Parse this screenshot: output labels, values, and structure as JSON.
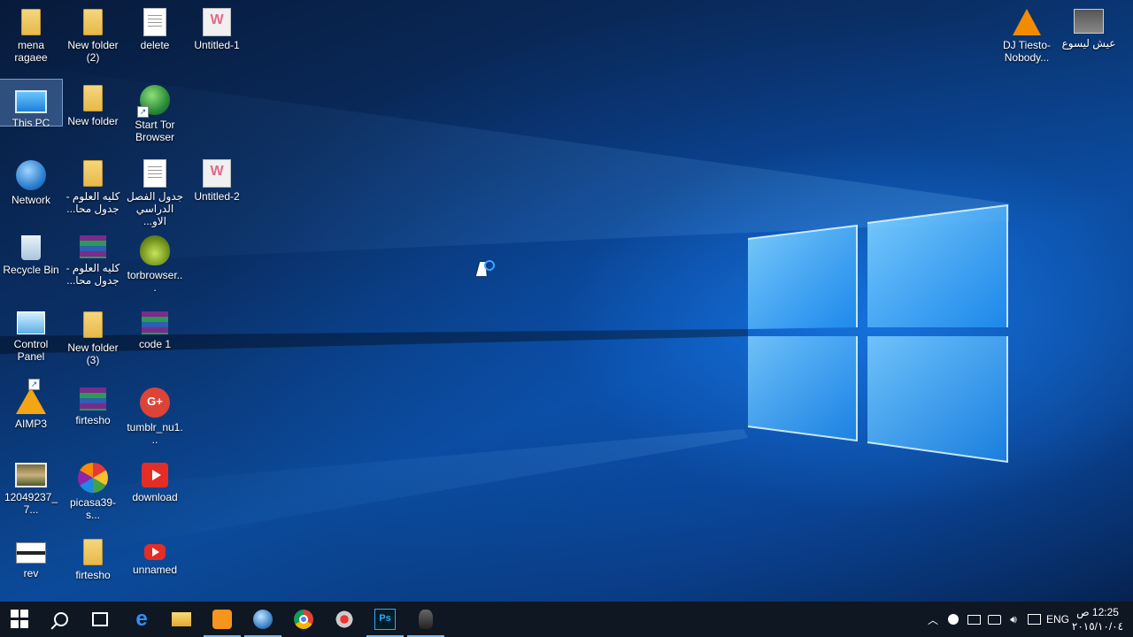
{
  "desktop": {
    "icons": [
      {
        "label": "mena ragaee"
      },
      {
        "label": "New folder (2)"
      },
      {
        "label": "delete"
      },
      {
        "label": "Untitled-1"
      },
      {
        "label": "This PC"
      },
      {
        "label": "New folder"
      },
      {
        "label": "Start Tor Browser"
      },
      {
        "label": "Network"
      },
      {
        "label": "كليه العلوم - جدول محا..."
      },
      {
        "label": "جدول الفصل الدراسي الاو..."
      },
      {
        "label": "Untitled-2"
      },
      {
        "label": "Recycle Bin"
      },
      {
        "label": "كليه العلوم - جدول محا..."
      },
      {
        "label": "torbrowser..."
      },
      {
        "label": "Control Panel"
      },
      {
        "label": "New folder (3)"
      },
      {
        "label": "code 1"
      },
      {
        "label": "AIMP3"
      },
      {
        "label": "firtesho"
      },
      {
        "label": "tumblr_nu1..."
      },
      {
        "label": "12049237_7..."
      },
      {
        "label": "picasa39-s..."
      },
      {
        "label": "download"
      },
      {
        "label": "rev"
      },
      {
        "label": "firtesho"
      },
      {
        "label": "unnamed"
      },
      {
        "label": "DJ Tiesto- Nobody..."
      },
      {
        "label": "عيش ليسوع"
      }
    ],
    "selected_icon": "This PC"
  },
  "taskbar": {
    "apps": [
      {
        "name": "start-button",
        "icon": "windows-logo-icon"
      },
      {
        "name": "search",
        "icon": "search-icon"
      },
      {
        "name": "task-view",
        "icon": "task-view-icon"
      },
      {
        "name": "edge",
        "icon": "edge-icon"
      },
      {
        "name": "file-explorer",
        "icon": "folder-icon"
      },
      {
        "name": "orange-app",
        "icon": "orange-app-icon"
      },
      {
        "name": "sphere-app",
        "icon": "sphere-icon"
      },
      {
        "name": "chrome",
        "icon": "chrome-icon"
      },
      {
        "name": "tool-app",
        "icon": "tool-icon"
      },
      {
        "name": "photoshop",
        "icon": "photoshop-icon",
        "glyph": "Ps"
      },
      {
        "name": "mouse-app",
        "icon": "mouse-icon"
      }
    ],
    "tray": {
      "language": "ENG",
      "time": "12:25 ص",
      "date": "٢٠١٥/١٠/٠٤"
    }
  },
  "colors": {
    "accent": "#76b9ed",
    "taskbar_bg": "#10182a"
  }
}
